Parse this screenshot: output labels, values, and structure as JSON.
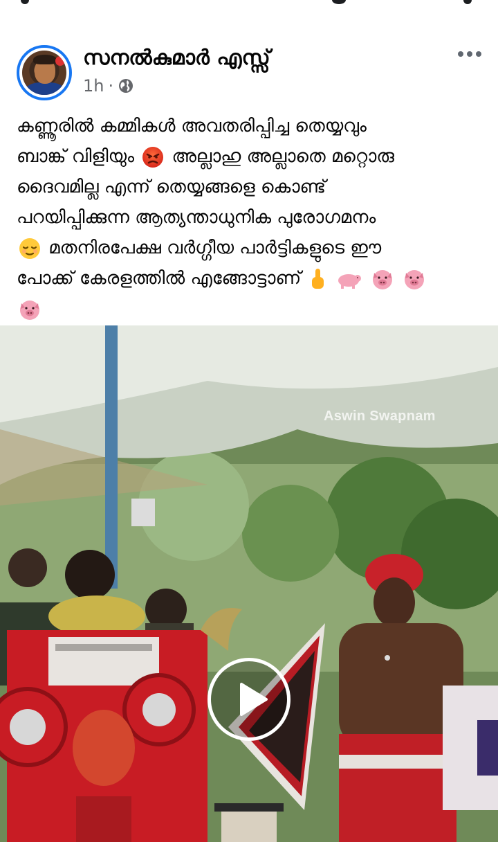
{
  "post": {
    "author": "സനൽകുമാർ എസ്സ്",
    "time": "1h",
    "separator": "·",
    "privacy_icon": "globe-icon",
    "menu_icon": "more-options-icon",
    "text_lines": [
      "കണ്ണൂരിൽ കമ്മികൾ അവതരിപ്പിച്ച തെയ്യവും",
      "ബാങ്ക് വിളിയും",
      "അല്ലാഹു അല്ലാതെ മറ്റൊരു",
      "ദൈവമില്ല എന്ന് തെയ്യങ്ങളെ കൊണ്ട്",
      "പറയിപ്പിക്കുന്ന ആത്യന്താധുനിക പുരോഗമനം",
      "മതനിരപേക്ഷ വർഗ്ഗീയ പാർട്ടികളുടെ ഈ",
      "പോക്ക് കേരളത്തിൽ എങ്ങോട്ടാണ്"
    ],
    "emojis": {
      "angry": "angry-face-emoji",
      "relieved": "relieved-face-emoji",
      "finger": "pointing-finger-emoji",
      "pig": "pig-emoji",
      "pig_face": "pig-face-emoji"
    }
  },
  "video": {
    "watermark": "Aswin Swapnam",
    "play_icon": "play-icon"
  },
  "colors": {
    "accent": "#1877f2",
    "text": "#050505",
    "secondary": "#65676b"
  }
}
